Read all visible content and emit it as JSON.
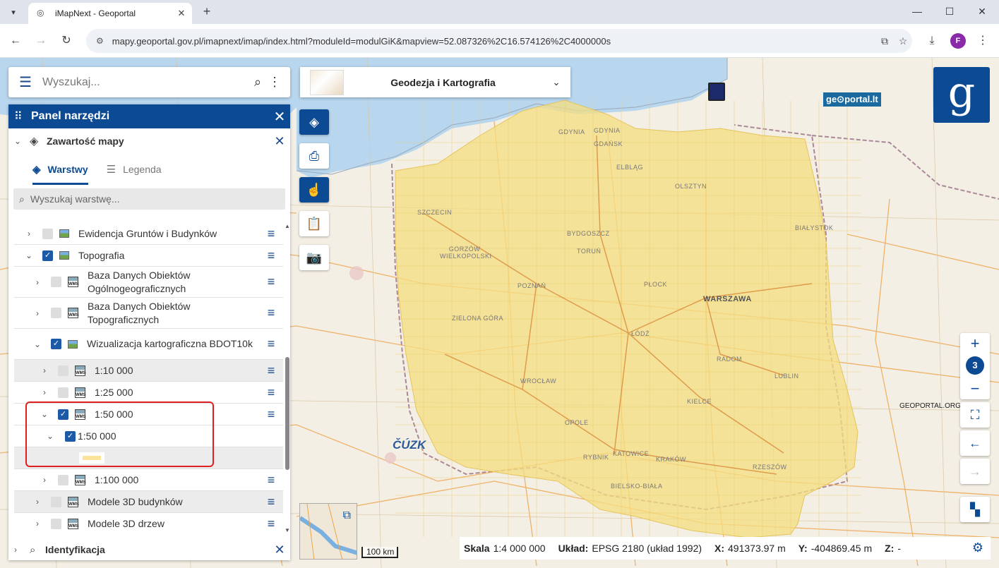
{
  "browser": {
    "tab_title": "iMapNext - Geoportal",
    "url": "mapy.geoportal.gov.pl/imapnext/imap/index.html?moduleId=modulGiK&mapview=52.087326%2C16.574126%2C4000000s",
    "profile_initial": "F"
  },
  "search": {
    "placeholder": "Wyszukaj..."
  },
  "theme": {
    "title": "Geodezja i Kartografia"
  },
  "panel": {
    "title": "Panel narzędzi",
    "section_title": "Zawartość mapy",
    "tab_layers": "Warstwy",
    "tab_legend": "Legenda",
    "layer_search_placeholder": "Wyszukaj warstwę...",
    "identify_title": "Identyfikacja"
  },
  "layers": [
    {
      "label": "Ewidencja Gruntów i Budynków",
      "checked": false,
      "expanded": false
    },
    {
      "label": "Topografia",
      "checked": true,
      "expanded": true
    },
    {
      "label": "Baza Danych Obiektów Ogólnogeograficznych",
      "checked": false,
      "expanded": false
    },
    {
      "label": "Baza Danych Obiektów Topograficznych",
      "checked": false,
      "expanded": false
    },
    {
      "label": "Wizualizacja kartograficzna BDOT10k",
      "checked": true,
      "expanded": true
    },
    {
      "label": "1:10 000",
      "checked": false,
      "expanded": false
    },
    {
      "label": "1:25 000",
      "checked": false,
      "expanded": false
    },
    {
      "label": "1:50 000",
      "checked": true,
      "expanded": true
    },
    {
      "label": "1:50 000",
      "checked": true,
      "expanded": true
    },
    {
      "label": "1:100 000",
      "checked": false,
      "expanded": false
    },
    {
      "label": "Modele 3D budynków",
      "checked": false,
      "expanded": false
    },
    {
      "label": "Modele 3D drzew",
      "checked": false,
      "expanded": false
    }
  ],
  "legend_swatch_color": "#fbe39a",
  "zoom": {
    "level": "3"
  },
  "scale_bar": "100 km",
  "status": {
    "scale_label": "Skala",
    "scale_value": "1:4 000 000",
    "crs_label": "Układ:",
    "crs_value": "EPSG 2180 (układ 1992)",
    "x_label": "X:",
    "x_value": "491373.97 m",
    "y_label": "Y:",
    "y_value": "-404869.45 m",
    "z_label": "Z:",
    "z_value": "-"
  },
  "map_labels": {
    "gdynia": "GDYNIA",
    "gdansk": "GDAŃSK",
    "elblag": "ELBLĄG",
    "olsztyn": "OLSZTYN",
    "szczecin": "SZCZECIN",
    "bydgoszcz": "BYDGOSZCZ",
    "torun": "TORUŃ",
    "bialystok": "BIAŁYSTOK",
    "gorzow": "GORZÓW WIELKOPOLSKI",
    "poznan": "POZNAŃ",
    "plock": "PŁOCK",
    "warszawa": "WARSZAWA",
    "zielona_gora": "ZIELONA GÓRA",
    "lodz": "ŁÓDŹ",
    "radom": "RADOM",
    "wroclaw": "WROCŁAW",
    "lublin": "LUBLIN",
    "kielce": "KIELCE",
    "opole": "OPOLE",
    "katowice": "KATOWICE",
    "rybnik": "RYBNIK",
    "krakow": "KRAKÓW",
    "rzeszow": "RZESZÓW",
    "bielsko": "BIELSKO-BIAŁA",
    "geoportal_lt": "ge⊙portal.lt",
    "cuzk": "ČÚZK",
    "geoportal_org": "GEOPORTAL.ORG"
  },
  "colors": {
    "primary": "#0d4a94",
    "coverage": "#f6dd80",
    "highlight": "#e02020"
  }
}
